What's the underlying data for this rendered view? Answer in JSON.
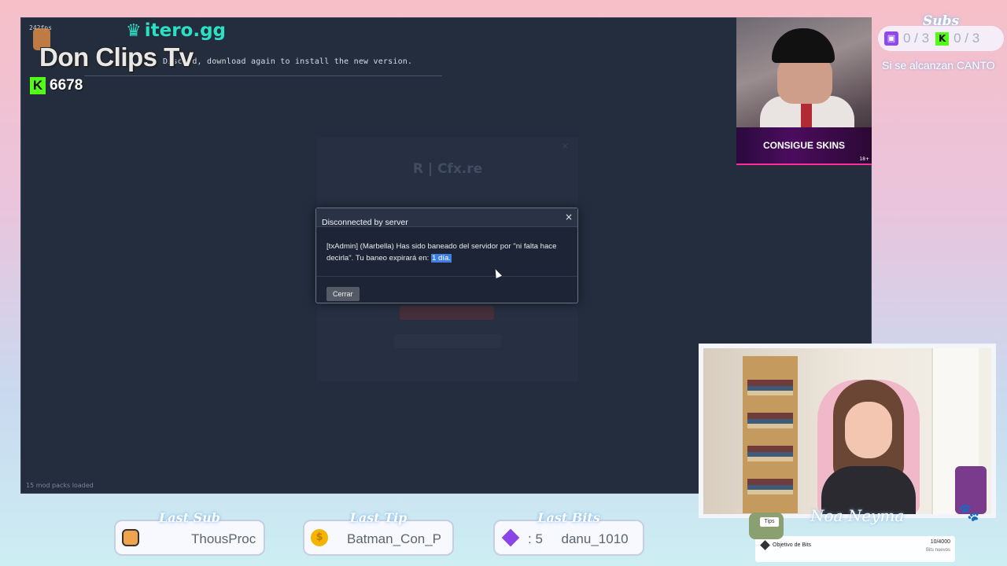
{
  "game": {
    "fps": "242fps",
    "console_text": "Discord, download again to install the new version.",
    "mods_loaded": "15 mod packs loaded",
    "background_logo": "R  |  Cfx.re",
    "dialog": {
      "title": "Disconnected by server",
      "message": "[txAdmin] (Marbella) Has sido baneado del servidor por \"ni falta hace decirla\". Tu baneo expirará en: ",
      "highlight": "1 día.",
      "button": "Cerrar",
      "close_glyph": "×"
    }
  },
  "overlay": {
    "sponsor": "itero.gg",
    "channel": "Don Clips Tv",
    "kick_followers": "6678",
    "kick_letter": "K",
    "skins_banner": "CONSIGUE SKINS",
    "skins_age": "18+",
    "subs_goal": {
      "title": "Subs",
      "twitch": "0 / 3",
      "kick": "0 / 3",
      "note": "Si se alcanzan CANTO"
    },
    "streamer_name": "Noa Neyma",
    "bits_goal": {
      "label": "Objetivo de Bits",
      "value": "10/4000",
      "sub": "Bits nuevos"
    },
    "tips_tag": "Tips",
    "stats": [
      {
        "title": "Last Sub",
        "value": "ThousProc",
        "icon": "cat-icon"
      },
      {
        "title": "Last Tip",
        "value": "Batman_Con_P",
        "icon": "coin-icon"
      },
      {
        "title": "Last Bits",
        "value": ": 5     danu_1010",
        "icon": "bits-gem-icon"
      }
    ]
  },
  "colors": {
    "kick_green": "#53fc18",
    "twitch_purple": "#8e4be8",
    "itero_teal": "#2de0c4",
    "selection_blue": "#3e7ee0"
  }
}
